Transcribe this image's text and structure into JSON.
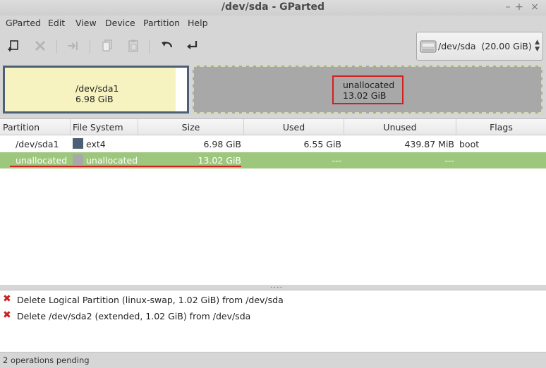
{
  "window": {
    "title": "/dev/sda - GParted",
    "controls": [
      "–",
      "+",
      "×"
    ]
  },
  "menu": [
    "GParted",
    "Edit",
    "View",
    "Device",
    "Partition",
    "Help"
  ],
  "toolbar": {
    "buttons": [
      "new-partition-icon",
      "delete-icon",
      "resize-move-icon",
      "copy-icon",
      "paste-icon",
      "undo-icon",
      "apply-icon"
    ]
  },
  "device_selector": {
    "value": "/dev/sda  (20.00 GiB)"
  },
  "disk_map": {
    "partition1": {
      "name": "/dev/sda1",
      "size": "6.98 GiB",
      "color": "#f6f3c0",
      "border": "#4c5f73"
    },
    "unallocated": {
      "name": "unallocated",
      "size": "13.02 GiB",
      "color": "#a8a8a8"
    }
  },
  "table": {
    "headers": [
      "Partition",
      "File System",
      "Size",
      "Used",
      "Unused",
      "Flags"
    ],
    "rows": [
      {
        "partition": "/dev/sda1",
        "fs": "ext4",
        "fs_color": "#4c5f73",
        "size": "6.98 GiB",
        "used": "6.55 GiB",
        "unused": "439.87 MiB",
        "flags": "boot"
      },
      {
        "partition": "unallocated",
        "fs": "unallocated",
        "fs_color": "#a8a8a8",
        "size": "13.02 GiB",
        "used": "---",
        "unused": "---",
        "flags": ""
      }
    ]
  },
  "operations": [
    "Delete Logical Partition (linux-swap, 1.02 GiB) from /dev/sda",
    "Delete /dev/sda2 (extended, 1.02 GiB) from /dev/sda"
  ],
  "status": "2 operations pending",
  "colors": {
    "selection": "#9ec77e",
    "highlight_red": "#d22020"
  }
}
